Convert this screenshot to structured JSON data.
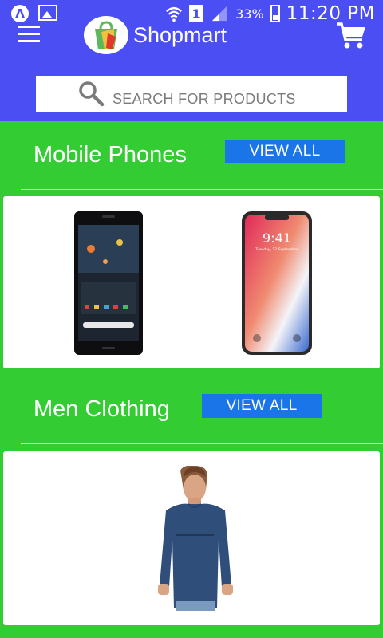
{
  "status_bar": {
    "sim_slot": "1",
    "battery": "33%",
    "time": "11:20 PM"
  },
  "header": {
    "brand": "Shopmart",
    "search_placeholder": "SEARCH FOR PRODUCTS"
  },
  "sections": [
    {
      "title": "Mobile Phones",
      "view_all": "VIEW ALL",
      "products": [
        {
          "name": "pixel-phone",
          "screen_time": ""
        },
        {
          "name": "iphone-x",
          "screen_time": "9:41",
          "screen_date": "Tuesday, 12 September"
        }
      ]
    },
    {
      "title": "Men Clothing",
      "view_all": "VIEW ALL",
      "products": [
        {
          "name": "navy-long-sleeve-tshirt"
        }
      ]
    }
  ],
  "colors": {
    "header": "#4b4ef2",
    "background": "#33cc33",
    "button": "#1a75e8"
  }
}
